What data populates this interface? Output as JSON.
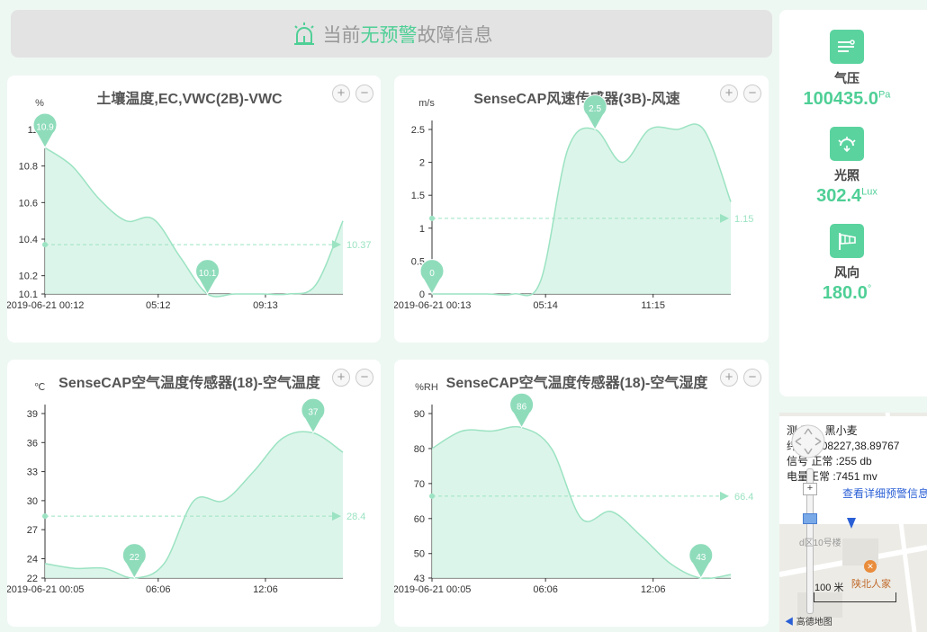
{
  "banner": {
    "prefix": "当前",
    "highlight": "无预警",
    "suffix": "故障信息"
  },
  "colors": {
    "accent": "#4fcf96",
    "fill": "#d6f3e6",
    "line": "#9be3c2"
  },
  "charts": [
    {
      "title": "土壤温度,EC,VWC(2B)-VWC",
      "unit": "%",
      "yticks": [
        "11",
        "10.8",
        "10.6",
        "10.4",
        "10.2",
        "10.1"
      ],
      "xticks": [
        "2019-06-21 00:12",
        "05:12",
        "09:13"
      ],
      "max_label": "10.9",
      "min_label": "10.1",
      "avg_label": "10.37"
    },
    {
      "title": "SenseCAP风速传感器(3B)-风速",
      "unit": "m/s",
      "yticks": [
        "2.5",
        "2",
        "1.5",
        "1",
        "0.5",
        "0"
      ],
      "xticks": [
        "2019-06-21 00:13",
        "05:14",
        "11:15"
      ],
      "max_label": "2.5",
      "min_label": "0",
      "avg_label": "1.15"
    },
    {
      "title": "SenseCAP空气温度传感器(18)-空气温度",
      "unit": "℃",
      "yticks": [
        "39",
        "36",
        "33",
        "30",
        "27",
        "24",
        "22"
      ],
      "xticks": [
        "2019-06-21 00:05",
        "06:06",
        "12:06"
      ],
      "max_label": "37",
      "min_label": "22",
      "avg_label": "28.4"
    },
    {
      "title": "SenseCAP空气温度传感器(18)-空气湿度",
      "unit": "%RH",
      "yticks": [
        "90",
        "80",
        "70",
        "60",
        "50",
        "43"
      ],
      "xticks": [
        "2019-06-21 00:05",
        "06:06",
        "12:06"
      ],
      "max_label": "86",
      "min_label": "43",
      "avg_label": "66.4"
    }
  ],
  "chart_data": [
    {
      "type": "area",
      "title": "土壤温度,EC,VWC(2B)-VWC",
      "ylabel": "%",
      "ylim": [
        10.1,
        11.0
      ],
      "x": [
        "00:12",
        "01:30",
        "02:45",
        "04:00",
        "05:12",
        "06:00",
        "07:00",
        "08:00",
        "09:13",
        "10:30",
        "11:30",
        "12:15"
      ],
      "values": [
        10.9,
        10.8,
        10.62,
        10.5,
        10.51,
        10.3,
        10.1,
        10.1,
        10.1,
        10.1,
        10.15,
        10.5
      ]
    },
    {
      "type": "area",
      "title": "SenseCAP风速传感器(3B)-风速",
      "ylabel": "m/s",
      "ylim": [
        0,
        2.5
      ],
      "x": [
        "00:13",
        "02:00",
        "04:00",
        "05:14",
        "06:10",
        "07:30",
        "08:30",
        "09:30",
        "10:30",
        "11:15",
        "12:00",
        "13:00"
      ],
      "values": [
        0,
        0,
        0,
        0,
        0.2,
        2.2,
        2.5,
        2.0,
        2.5,
        2.5,
        2.5,
        1.4
      ]
    },
    {
      "type": "area",
      "title": "SenseCAP空气温度传感器(18)-空气温度",
      "ylabel": "℃",
      "ylim": [
        22,
        39
      ],
      "x": [
        "00:05",
        "01:30",
        "03:00",
        "04:30",
        "06:06",
        "07:30",
        "09:00",
        "10:30",
        "12:06",
        "13:00",
        "13:30"
      ],
      "values": [
        23.5,
        23,
        23,
        22,
        23.5,
        30,
        30,
        33,
        36.5,
        37,
        35
      ]
    },
    {
      "type": "area",
      "title": "SenseCAP空气温度传感器(18)-空气湿度",
      "ylabel": "%RH",
      "ylim": [
        43,
        90
      ],
      "x": [
        "00:05",
        "01:30",
        "03:00",
        "04:30",
        "06:06",
        "07:30",
        "09:00",
        "10:30",
        "12:06",
        "13:00",
        "13:30"
      ],
      "values": [
        80,
        85,
        85,
        86,
        80,
        60,
        62,
        55,
        47,
        43,
        44
      ]
    }
  ],
  "metrics": [
    {
      "label": "气压",
      "value": "100435.0",
      "unit": "Pa",
      "icon": "pressure-icon"
    },
    {
      "label": "光照",
      "value": "302.4",
      "unit": "Lux",
      "icon": "light-icon"
    },
    {
      "label": "风向",
      "value": "180.0",
      "unit": "°",
      "icon": "wind-direction-icon"
    }
  ],
  "map": {
    "name_line": "测 称： 黑小麦",
    "coord_line": "纬 15.508227,38.89767",
    "signal_line": "信号 正常 :255 db",
    "battery_line": "电量正常 :7451 mv",
    "detail_link": "查看详细预警信息",
    "poi_label": "陕北人家",
    "building_label": "d区10号楼",
    "scale_label": "100 米",
    "brand": "高德地图"
  }
}
